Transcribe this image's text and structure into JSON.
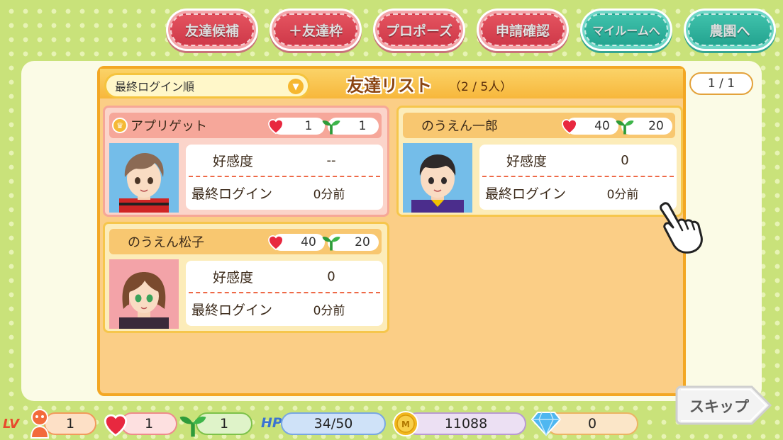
{
  "top_buttons": {
    "friend_candidates": "友達候補",
    "add_friend_slot": "＋友達枠",
    "propose": "プロポーズ",
    "request_check": "申請確認",
    "to_my_room": "マイルームへ",
    "to_farm": "農園へ"
  },
  "panel": {
    "sort_select": "最終ログイン順",
    "title": "友達リスト",
    "count": "（2 / 5人）",
    "page": "1 / 1"
  },
  "friends": [
    {
      "name": "アプリゲット",
      "hearts": "1",
      "sprouts": "1",
      "affinity_label": "好感度",
      "affinity_value": "--",
      "last_login_label": "最終ログイン",
      "last_login_value": "0分前"
    },
    {
      "name": "のうえん一郎",
      "hearts": "40",
      "sprouts": "20",
      "affinity_label": "好感度",
      "affinity_value": "0",
      "last_login_label": "最終ログイン",
      "last_login_value": "0分前"
    },
    {
      "name": "のうえん松子",
      "hearts": "40",
      "sprouts": "20",
      "affinity_label": "好感度",
      "affinity_value": "0",
      "last_login_label": "最終ログイン",
      "last_login_value": "0分前"
    }
  ],
  "skip_label": "スキップ",
  "status": {
    "lv_label": "LV",
    "level": "1",
    "hearts": "1",
    "sprouts": "1",
    "hp_label": "HP",
    "hp": "34/50",
    "coins": "11088",
    "gems": "0"
  },
  "colors": {
    "background": "#c9e27a",
    "panel": "#fbce86",
    "panel_border": "#f3a723",
    "pink_button": "#d94453",
    "teal_button": "#30b39e",
    "heart": "#e8283f",
    "sprout": "#2e9b3a",
    "hp": "#3b73d1"
  },
  "icons": [
    "crown-icon",
    "heart-icon",
    "sprout-icon",
    "dropdown-arrow-icon",
    "pointer-hand-icon",
    "person-icon",
    "coin-icon",
    "gem-icon"
  ]
}
